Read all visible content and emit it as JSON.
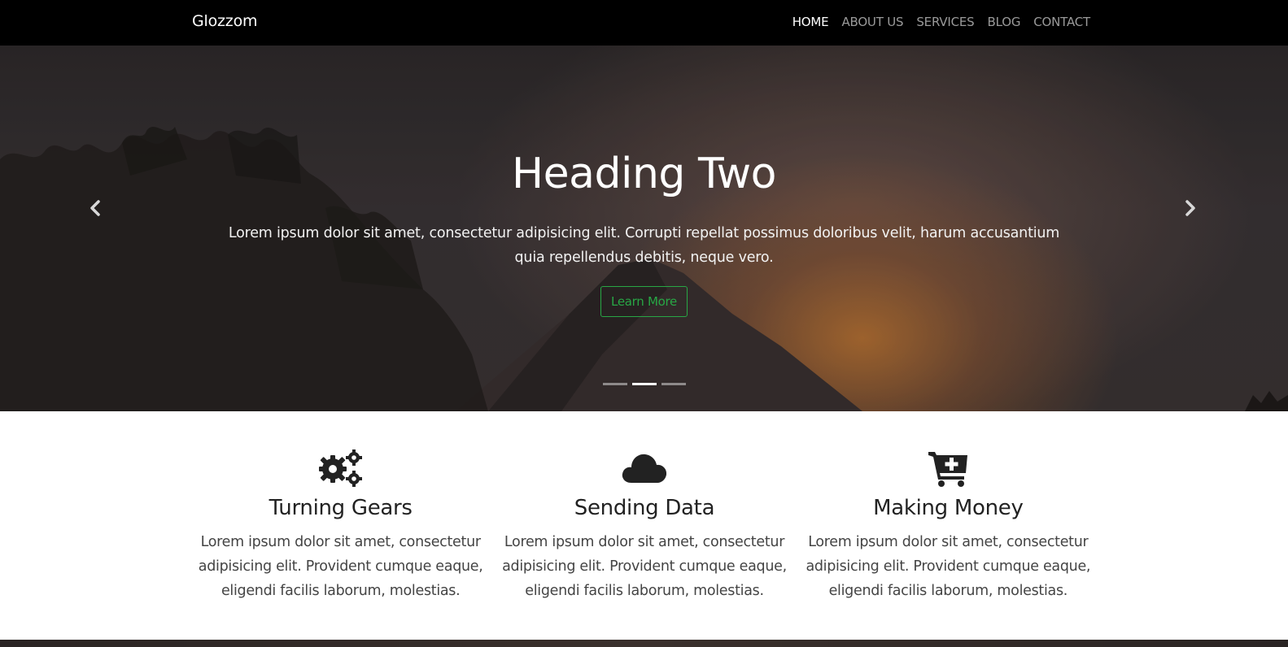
{
  "navbar": {
    "brand": "Glozzom",
    "items": [
      {
        "label": "HOME",
        "active": true
      },
      {
        "label": "ABOUT US",
        "active": false
      },
      {
        "label": "SERVICES",
        "active": false
      },
      {
        "label": "BLOG",
        "active": false
      },
      {
        "label": "CONTACT",
        "active": false
      }
    ]
  },
  "hero": {
    "title": "Heading Two",
    "text": "Lorem ipsum dolor sit amet, consectetur adipisicing elit. Corrupti repellat possimus doloribus velit, harum accusantium quia repellendus debitis, neque vero.",
    "button_label": "Learn More",
    "prev_icon": "chevron-left-icon",
    "next_icon": "chevron-right-icon",
    "slides_count": 3,
    "active_slide": 2,
    "accent_color": "#28a745"
  },
  "features": [
    {
      "icon": "gears-icon",
      "title": "Turning Gears",
      "text": "Lorem ipsum dolor sit amet, consectetur adipisicing elit. Provident cumque eaque, eligendi facilis laborum, molestias."
    },
    {
      "icon": "cloud-icon",
      "title": "Sending Data",
      "text": "Lorem ipsum dolor sit amet, consectetur adipisicing elit. Provident cumque eaque, eligendi facilis laborum, molestias."
    },
    {
      "icon": "cart-plus-icon",
      "title": "Making Money",
      "text": "Lorem ipsum dolor sit amet, consectetur adipisicing elit. Provident cumque eaque, eligendi facilis laborum, molestias."
    }
  ]
}
